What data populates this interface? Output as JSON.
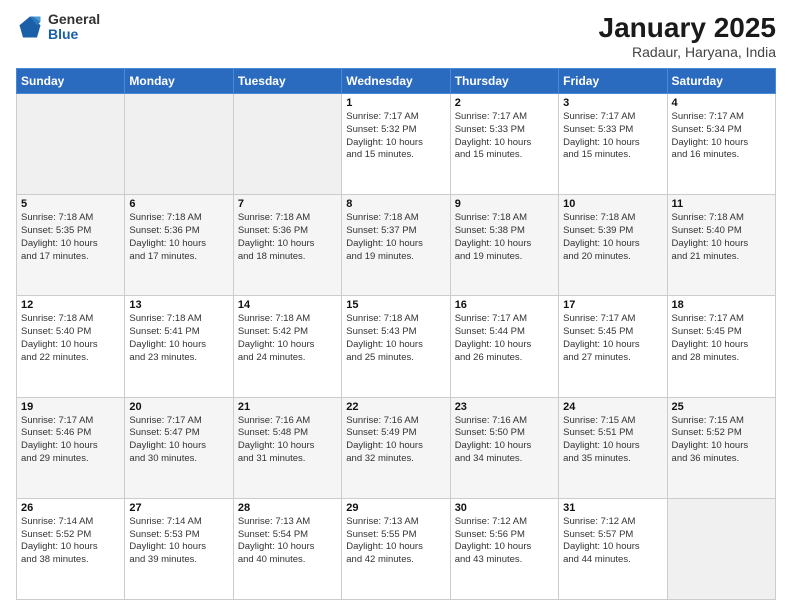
{
  "logo": {
    "general": "General",
    "blue": "Blue"
  },
  "header": {
    "month": "January 2025",
    "location": "Radaur, Haryana, India"
  },
  "weekdays": [
    "Sunday",
    "Monday",
    "Tuesday",
    "Wednesday",
    "Thursday",
    "Friday",
    "Saturday"
  ],
  "weeks": [
    [
      {
        "day": "",
        "info": ""
      },
      {
        "day": "",
        "info": ""
      },
      {
        "day": "",
        "info": ""
      },
      {
        "day": "1",
        "info": "Sunrise: 7:17 AM\nSunset: 5:32 PM\nDaylight: 10 hours\nand 15 minutes."
      },
      {
        "day": "2",
        "info": "Sunrise: 7:17 AM\nSunset: 5:33 PM\nDaylight: 10 hours\nand 15 minutes."
      },
      {
        "day": "3",
        "info": "Sunrise: 7:17 AM\nSunset: 5:33 PM\nDaylight: 10 hours\nand 15 minutes."
      },
      {
        "day": "4",
        "info": "Sunrise: 7:17 AM\nSunset: 5:34 PM\nDaylight: 10 hours\nand 16 minutes."
      }
    ],
    [
      {
        "day": "5",
        "info": "Sunrise: 7:18 AM\nSunset: 5:35 PM\nDaylight: 10 hours\nand 17 minutes."
      },
      {
        "day": "6",
        "info": "Sunrise: 7:18 AM\nSunset: 5:36 PM\nDaylight: 10 hours\nand 17 minutes."
      },
      {
        "day": "7",
        "info": "Sunrise: 7:18 AM\nSunset: 5:36 PM\nDaylight: 10 hours\nand 18 minutes."
      },
      {
        "day": "8",
        "info": "Sunrise: 7:18 AM\nSunset: 5:37 PM\nDaylight: 10 hours\nand 19 minutes."
      },
      {
        "day": "9",
        "info": "Sunrise: 7:18 AM\nSunset: 5:38 PM\nDaylight: 10 hours\nand 19 minutes."
      },
      {
        "day": "10",
        "info": "Sunrise: 7:18 AM\nSunset: 5:39 PM\nDaylight: 10 hours\nand 20 minutes."
      },
      {
        "day": "11",
        "info": "Sunrise: 7:18 AM\nSunset: 5:40 PM\nDaylight: 10 hours\nand 21 minutes."
      }
    ],
    [
      {
        "day": "12",
        "info": "Sunrise: 7:18 AM\nSunset: 5:40 PM\nDaylight: 10 hours\nand 22 minutes."
      },
      {
        "day": "13",
        "info": "Sunrise: 7:18 AM\nSunset: 5:41 PM\nDaylight: 10 hours\nand 23 minutes."
      },
      {
        "day": "14",
        "info": "Sunrise: 7:18 AM\nSunset: 5:42 PM\nDaylight: 10 hours\nand 24 minutes."
      },
      {
        "day": "15",
        "info": "Sunrise: 7:18 AM\nSunset: 5:43 PM\nDaylight: 10 hours\nand 25 minutes."
      },
      {
        "day": "16",
        "info": "Sunrise: 7:17 AM\nSunset: 5:44 PM\nDaylight: 10 hours\nand 26 minutes."
      },
      {
        "day": "17",
        "info": "Sunrise: 7:17 AM\nSunset: 5:45 PM\nDaylight: 10 hours\nand 27 minutes."
      },
      {
        "day": "18",
        "info": "Sunrise: 7:17 AM\nSunset: 5:45 PM\nDaylight: 10 hours\nand 28 minutes."
      }
    ],
    [
      {
        "day": "19",
        "info": "Sunrise: 7:17 AM\nSunset: 5:46 PM\nDaylight: 10 hours\nand 29 minutes."
      },
      {
        "day": "20",
        "info": "Sunrise: 7:17 AM\nSunset: 5:47 PM\nDaylight: 10 hours\nand 30 minutes."
      },
      {
        "day": "21",
        "info": "Sunrise: 7:16 AM\nSunset: 5:48 PM\nDaylight: 10 hours\nand 31 minutes."
      },
      {
        "day": "22",
        "info": "Sunrise: 7:16 AM\nSunset: 5:49 PM\nDaylight: 10 hours\nand 32 minutes."
      },
      {
        "day": "23",
        "info": "Sunrise: 7:16 AM\nSunset: 5:50 PM\nDaylight: 10 hours\nand 34 minutes."
      },
      {
        "day": "24",
        "info": "Sunrise: 7:15 AM\nSunset: 5:51 PM\nDaylight: 10 hours\nand 35 minutes."
      },
      {
        "day": "25",
        "info": "Sunrise: 7:15 AM\nSunset: 5:52 PM\nDaylight: 10 hours\nand 36 minutes."
      }
    ],
    [
      {
        "day": "26",
        "info": "Sunrise: 7:14 AM\nSunset: 5:52 PM\nDaylight: 10 hours\nand 38 minutes."
      },
      {
        "day": "27",
        "info": "Sunrise: 7:14 AM\nSunset: 5:53 PM\nDaylight: 10 hours\nand 39 minutes."
      },
      {
        "day": "28",
        "info": "Sunrise: 7:13 AM\nSunset: 5:54 PM\nDaylight: 10 hours\nand 40 minutes."
      },
      {
        "day": "29",
        "info": "Sunrise: 7:13 AM\nSunset: 5:55 PM\nDaylight: 10 hours\nand 42 minutes."
      },
      {
        "day": "30",
        "info": "Sunrise: 7:12 AM\nSunset: 5:56 PM\nDaylight: 10 hours\nand 43 minutes."
      },
      {
        "day": "31",
        "info": "Sunrise: 7:12 AM\nSunset: 5:57 PM\nDaylight: 10 hours\nand 44 minutes."
      },
      {
        "day": "",
        "info": ""
      }
    ]
  ]
}
